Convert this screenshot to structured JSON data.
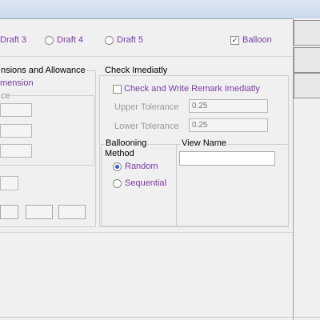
{
  "tabs": {
    "draft3": "Draft 3",
    "draft4": "Draft 4",
    "draft5": "Draft 5",
    "balloon": "Balloon",
    "balloon_checked": "✓"
  },
  "left_group": {
    "title": "nsions and Allowance",
    "dimension_label": "mension",
    "subgroup_label": "ce"
  },
  "check_group": {
    "title": "Check Imediatly",
    "checkbox_label": "Check and Write Remark Imediatly",
    "upper_label": "Upper Tolerance",
    "upper_value": "0.25",
    "lower_label": "Lower Tolerance",
    "lower_value": "0.25"
  },
  "ballooning": {
    "title_line1": "Ballooning",
    "title_line2": "Method",
    "random": "Random",
    "sequential": "Sequential",
    "selected": "Random"
  },
  "view_name": {
    "title": "View Name",
    "value": ""
  },
  "colors": {
    "accent_text": "#7b3aa5",
    "radio_selected": "#1e5cc8"
  }
}
